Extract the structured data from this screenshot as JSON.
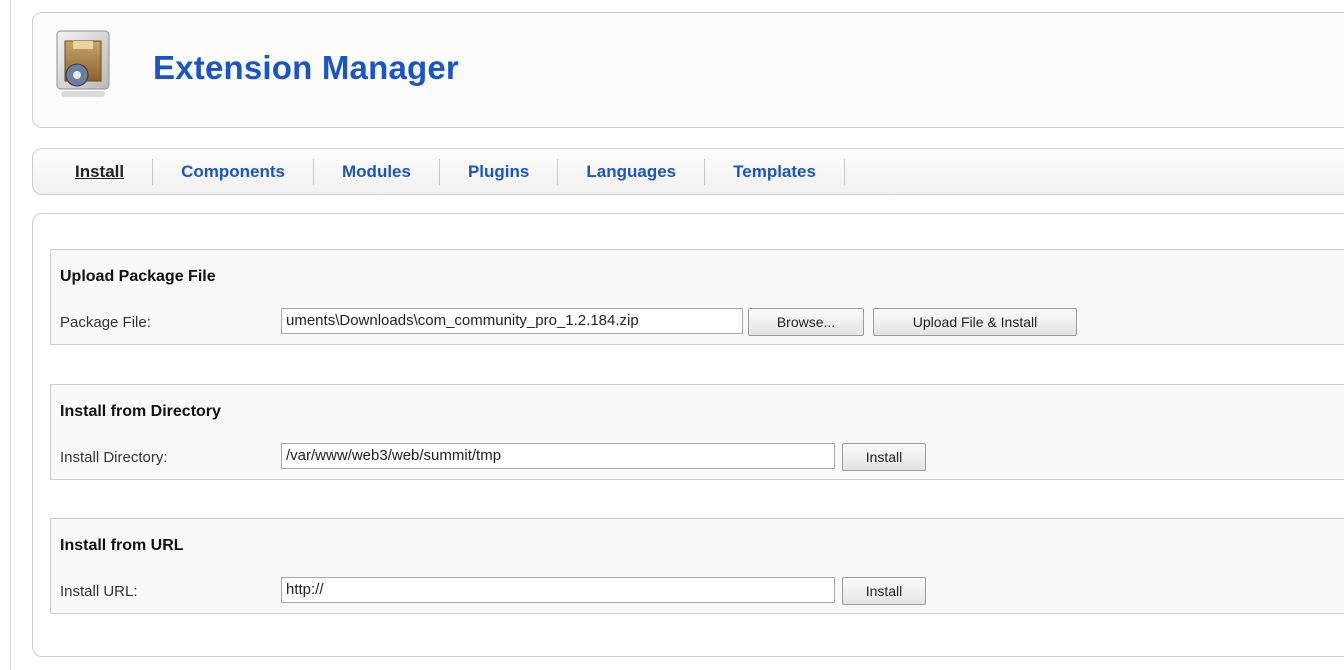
{
  "header": {
    "title": "Extension Manager",
    "icon": "extension-box-icon"
  },
  "tabs": [
    {
      "label": "Install",
      "active": true
    },
    {
      "label": "Components",
      "active": false
    },
    {
      "label": "Modules",
      "active": false
    },
    {
      "label": "Plugins",
      "active": false
    },
    {
      "label": "Languages",
      "active": false
    },
    {
      "label": "Templates",
      "active": false
    }
  ],
  "upload": {
    "title": "Upload Package File",
    "label": "Package File:",
    "value": "uments\\Downloads\\com_community_pro_1.2.184.zip",
    "browse_label": "Browse...",
    "submit_label": "Upload File & Install"
  },
  "directory": {
    "title": "Install from Directory",
    "label": "Install Directory:",
    "value": "/var/www/web3/web/summit/tmp",
    "submit_label": "Install"
  },
  "url": {
    "title": "Install from URL",
    "label": "Install URL:",
    "value": "http://",
    "submit_label": "Install"
  },
  "colors": {
    "link": "#1a55c8",
    "active_tab": "#222222",
    "border": "#cccccc"
  }
}
